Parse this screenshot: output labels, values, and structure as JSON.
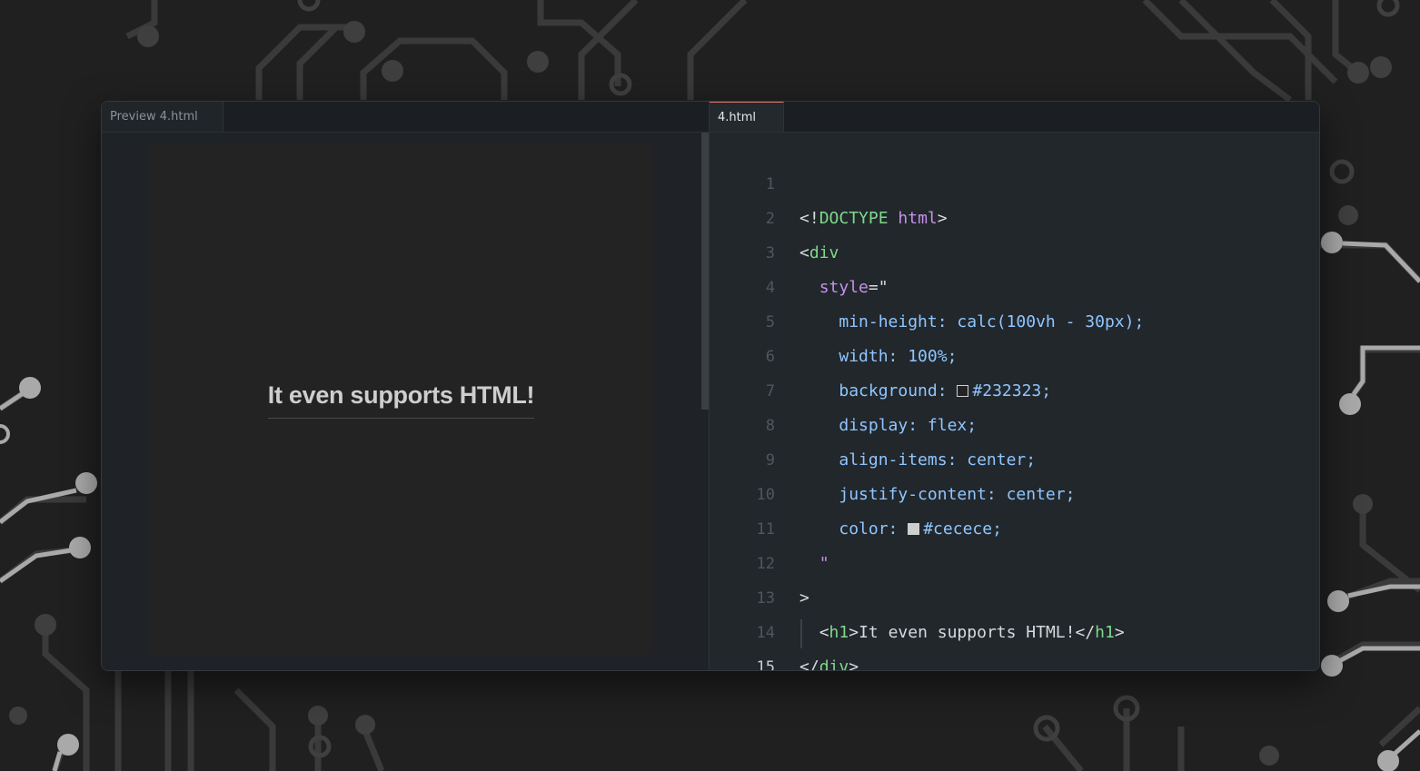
{
  "preview": {
    "tab_label": "Preview 4.html",
    "heading": "It even supports HTML!"
  },
  "editor": {
    "tab_label": "4.html",
    "active_line": 15,
    "line_numbers": [
      "1",
      "2",
      "3",
      "4",
      "5",
      "6",
      "7",
      "8",
      "9",
      "10",
      "11",
      "12",
      "13",
      "14",
      "15"
    ],
    "swatch_colors": {
      "background": "#232323",
      "color": "#cecece"
    },
    "lines": {
      "l1": {
        "open": "<!",
        "doctype": "DOCTYPE",
        "sp": " ",
        "html": "html",
        "close": ">"
      },
      "l2": {
        "open": "<",
        "tag": "div"
      },
      "l3": {
        "indent": "  ",
        "attr": "style",
        "eq": "=\""
      },
      "l4": {
        "indent": "    ",
        "text": "min-height: calc(100vh - 30px);"
      },
      "l5": {
        "indent": "    ",
        "text": "width: 100%;"
      },
      "l6": {
        "indent": "    ",
        "prop": "background: ",
        "value": "#232323;"
      },
      "l7": {
        "indent": "    ",
        "text": "display: flex;"
      },
      "l8": {
        "indent": "    ",
        "text": "align-items: center;"
      },
      "l9": {
        "indent": "    ",
        "text": "justify-content: center;"
      },
      "l10": {
        "indent": "    ",
        "prop": "color: ",
        "value": "#cecece;"
      },
      "l11": {
        "indent": "  ",
        "text": "\""
      },
      "l12": {
        "text": ">"
      },
      "l13": {
        "indent": "  ",
        "lt": "<",
        "tag": "h1",
        "gt": ">",
        "content": "It even supports HTML!",
        "lt2": "</",
        "tag2": "h1",
        "gt2": ">"
      },
      "l14": {
        "lt": "</",
        "tag": "div",
        "gt": ">"
      }
    }
  },
  "colors": {
    "accent_tab_border": "#d9756d",
    "tag": "#7ed98b",
    "attribute": "#c591e8",
    "css": "#8fc6ff"
  }
}
